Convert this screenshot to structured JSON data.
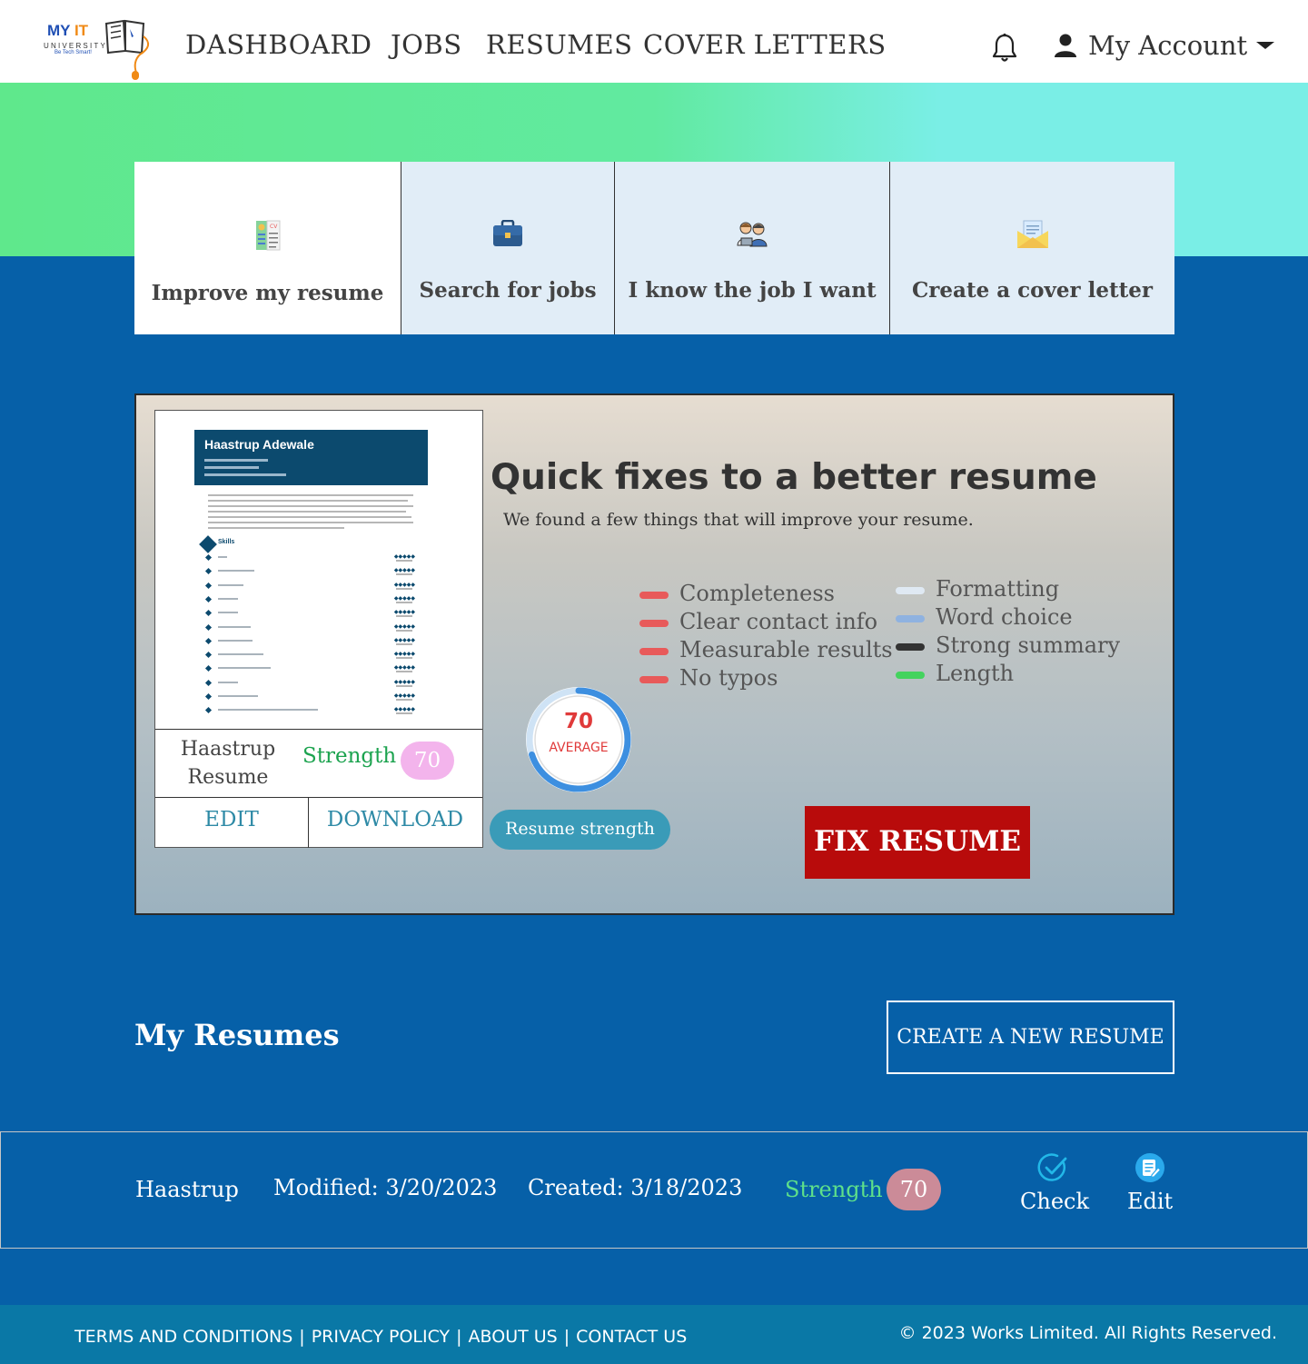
{
  "header": {
    "logo": {
      "brand_a": "MY",
      "brand_b": "IT",
      "sub": "UNIVERSITY",
      "tagline": "Be Tech Smart!"
    },
    "nav": [
      "DASHBOARD",
      "JOBS",
      "RESUMES",
      "COVER LETTERS"
    ],
    "account_label": "My Account"
  },
  "tiles": [
    {
      "label": "Improve my resume",
      "icon": "resume-icon",
      "active": true
    },
    {
      "label": "Search for jobs",
      "icon": "briefcase-icon",
      "active": false
    },
    {
      "label": "I know the job I want",
      "icon": "people-icon",
      "active": false
    },
    {
      "label": "Create a cover letter",
      "icon": "envelope-icon",
      "active": false
    }
  ],
  "quick_fixes": {
    "title": "Quick fixes to a better resume",
    "subtitle": "We found a few things that will improve your resume.",
    "preview": {
      "person_name": "Haastrup Adewale",
      "skills_heading": "Skills",
      "skill_count": 12
    },
    "card": {
      "name": "Haastrup Resume",
      "strength_label": "Strength",
      "score": "70",
      "edit_label": "EDIT",
      "download_label": "DOWNLOAD"
    },
    "legend_left": [
      {
        "label": "Completeness",
        "color": "#e85a5a"
      },
      {
        "label": "Clear contact info",
        "color": "#e85a5a"
      },
      {
        "label": "Measurable results",
        "color": "#e85a5a"
      },
      {
        "label": "No typos",
        "color": "#e85a5a"
      }
    ],
    "legend_right": [
      {
        "label": "Formatting",
        "color": "#dfe9f3"
      },
      {
        "label": "Word choice",
        "color": "#8fb2e0"
      },
      {
        "label": "Strong summary",
        "color": "#333333"
      },
      {
        "label": "Length",
        "color": "#44d35e"
      }
    ],
    "gauge": {
      "value": "70",
      "label": "AVERAGE",
      "fraction": 0.7
    },
    "strength_pill": "Resume strength",
    "fix_button": "FIX RESUME"
  },
  "my_resumes": {
    "title": "My Resumes",
    "create_button": "CREATE A NEW RESUME",
    "rows": [
      {
        "name": "Haastrup",
        "modified": "Modified: 3/20/2023",
        "created": "Created: 3/18/2023",
        "strength_label": "Strength",
        "score": "70",
        "check_label": "Check",
        "edit_label": "Edit"
      }
    ]
  },
  "footer": {
    "links": [
      "TERMS AND CONDITIONS",
      "PRIVACY POLICY",
      "ABOUT US",
      "CONTACT US"
    ],
    "separator": "|",
    "copyright": "© 2023 Works Limited. All Rights Reserved."
  },
  "colors": {
    "primary_blue": "#0660a8",
    "fix_red": "#b80b0b",
    "strength_green": "#1ca34f"
  }
}
